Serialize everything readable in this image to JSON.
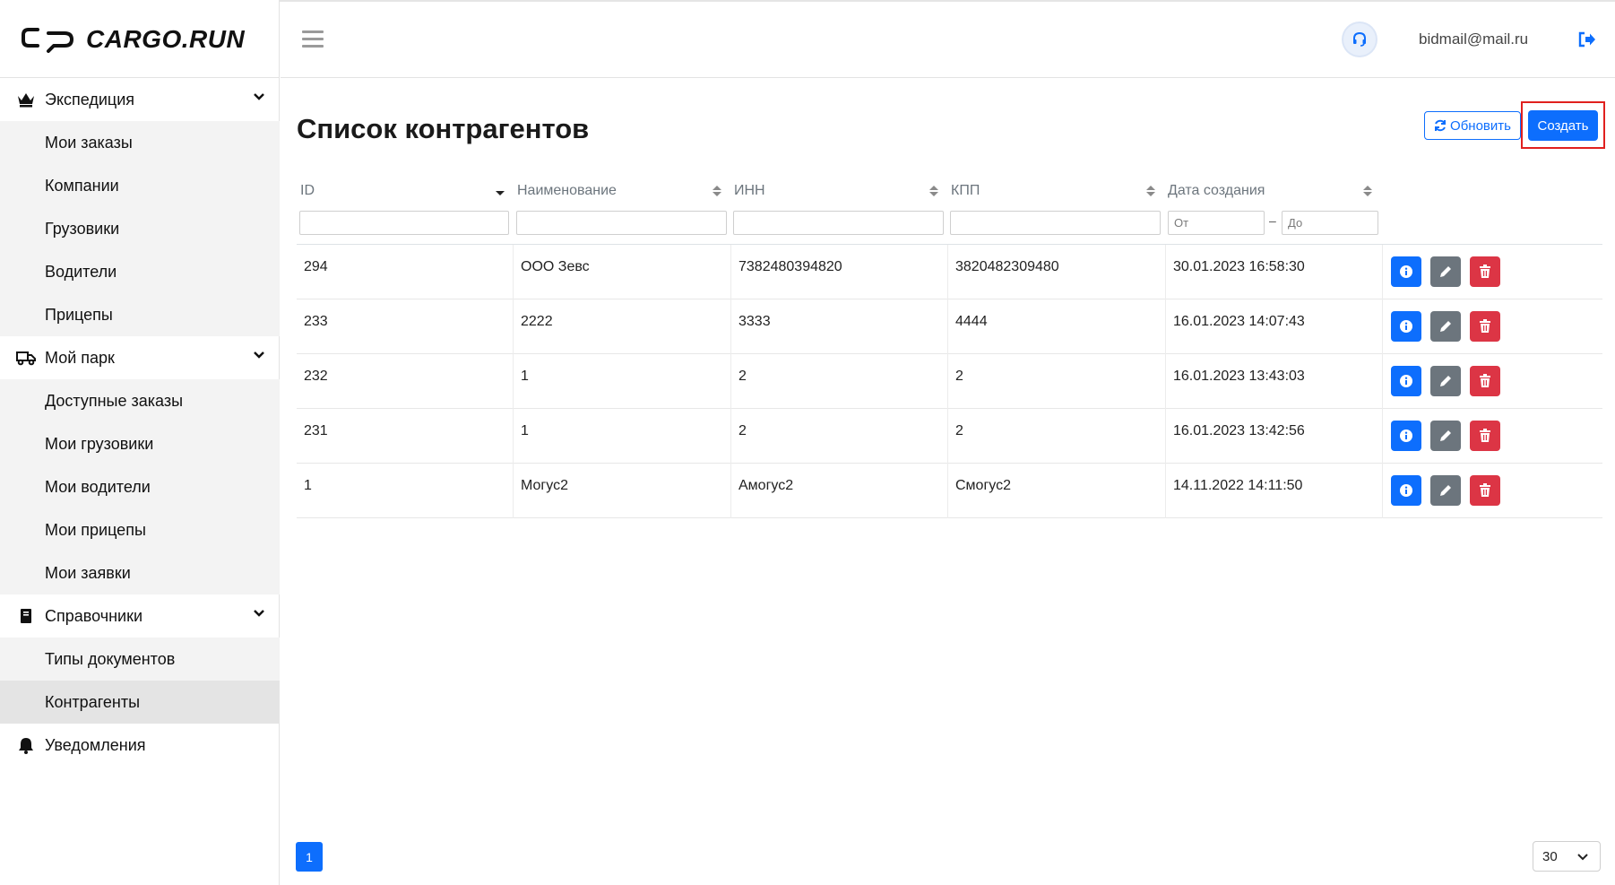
{
  "brand": {
    "logo_text": "CARGO.RUN"
  },
  "header": {
    "user_email": "bidmail@mail.ru"
  },
  "sidebar": {
    "groups": [
      {
        "label": "Экспедиция",
        "items": [
          "Мои заказы",
          "Компании",
          "Грузовики",
          "Водители",
          "Прицепы"
        ]
      },
      {
        "label": "Мой парк",
        "items": [
          "Доступные заказы",
          "Мои грузовики",
          "Мои водители",
          "Мои прицепы",
          "Мои заявки"
        ]
      },
      {
        "label": "Справочники",
        "items": [
          "Типы документов",
          "Контрагенты"
        ]
      },
      {
        "label": "Уведомления",
        "items": []
      }
    ],
    "active_item": "Контрагенты"
  },
  "main": {
    "title": "Список контрагентов",
    "refresh_label": "Обновить",
    "create_label": "Создать"
  },
  "table": {
    "columns": [
      "ID",
      "Наименование",
      "ИНН",
      "КПП",
      "Дата создания"
    ],
    "date_from_placeholder": "От",
    "date_to_placeholder": "До",
    "rows": [
      [
        "294",
        "ООО Зевс",
        "7382480394820",
        "3820482309480",
        "30.01.2023 16:58:30"
      ],
      [
        "233",
        "2222",
        "3333",
        "4444",
        "16.01.2023 14:07:43"
      ],
      [
        "232",
        "1",
        "2",
        "2",
        "16.01.2023 13:43:03"
      ],
      [
        "231",
        "1",
        "2",
        "2",
        "16.01.2023 13:42:56"
      ],
      [
        "1",
        "Могус2",
        "Амогус2",
        "Смогус2",
        "14.11.2022 14:11:50"
      ]
    ]
  },
  "pagination": {
    "current_page": "1",
    "page_size": "30"
  },
  "colors": {
    "primary": "#0d6efd",
    "secondary": "#6c757d",
    "danger": "#dc3545",
    "highlight_frame": "#e0201e"
  }
}
